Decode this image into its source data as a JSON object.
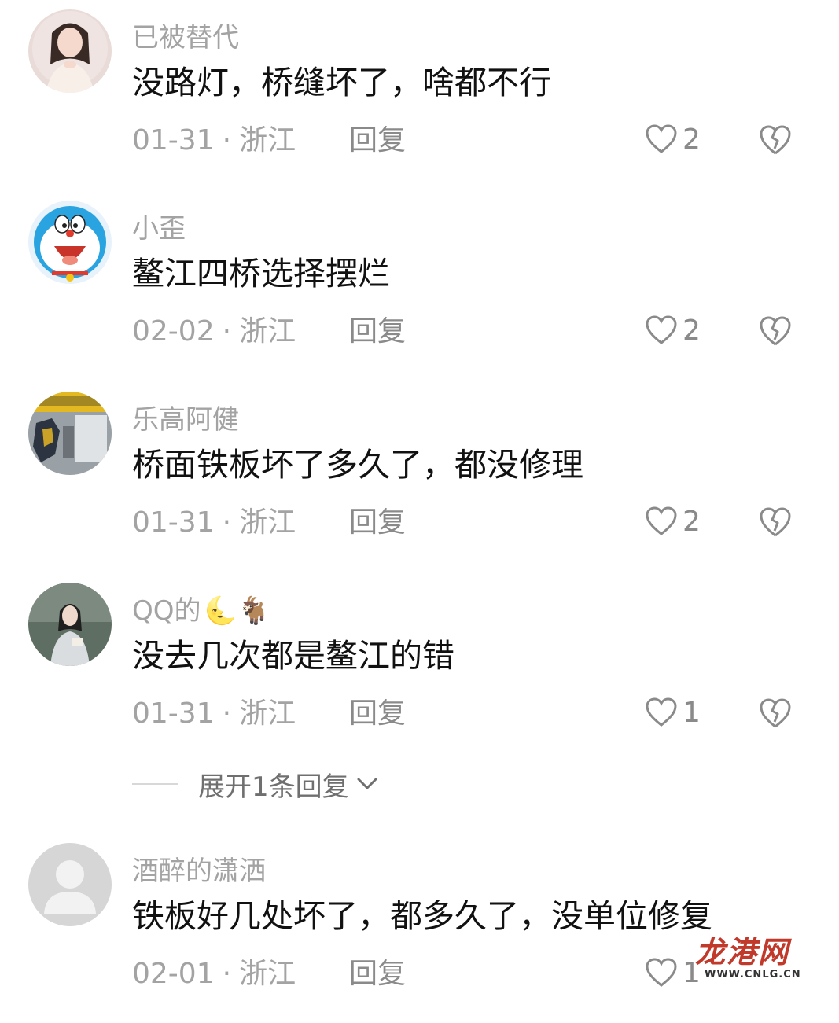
{
  "comments": [
    {
      "username": "已被替代",
      "text": "没路灯，桥缝坏了，啥都不行",
      "date": "01-31",
      "location": "浙江",
      "reply_label": "回复",
      "likes": "2",
      "avatar": "portrait-photo-girl"
    },
    {
      "username": "小歪",
      "text": "鳌江四桥选择摆烂",
      "date": "02-02",
      "location": "浙江",
      "reply_label": "回复",
      "likes": "2",
      "avatar": "doraemon-cartoon"
    },
    {
      "username": "乐高阿健",
      "text": "桥面铁板坏了多久了，都没修理",
      "date": "01-31",
      "location": "浙江",
      "reply_label": "回复",
      "likes": "2",
      "avatar": "lego-store-photo"
    },
    {
      "username": "QQ的",
      "username_emoji": "🌜🐐",
      "text": "没去几次都是鳌江的错",
      "date": "01-31",
      "location": "浙江",
      "reply_label": "回复",
      "likes": "1",
      "avatar": "hanfu-girl-photo"
    },
    {
      "username": "酒醉的潇洒",
      "text": "铁板好几处坏了，都多久了，没单位修复",
      "date": "02-01",
      "location": "浙江",
      "reply_label": "回复",
      "likes": "1",
      "avatar": "default-user-avatar"
    }
  ],
  "expand_replies": {
    "label": "展开1条回复"
  },
  "meta_separator": "·",
  "watermark": {
    "logo": "龙港网",
    "url": "WWW.CNLG.CN"
  },
  "colors": {
    "text_primary": "#111111",
    "text_secondary": "#a3a3a3",
    "icon_gray": "#8a8a8a",
    "watermark_red": "#c0392b"
  }
}
